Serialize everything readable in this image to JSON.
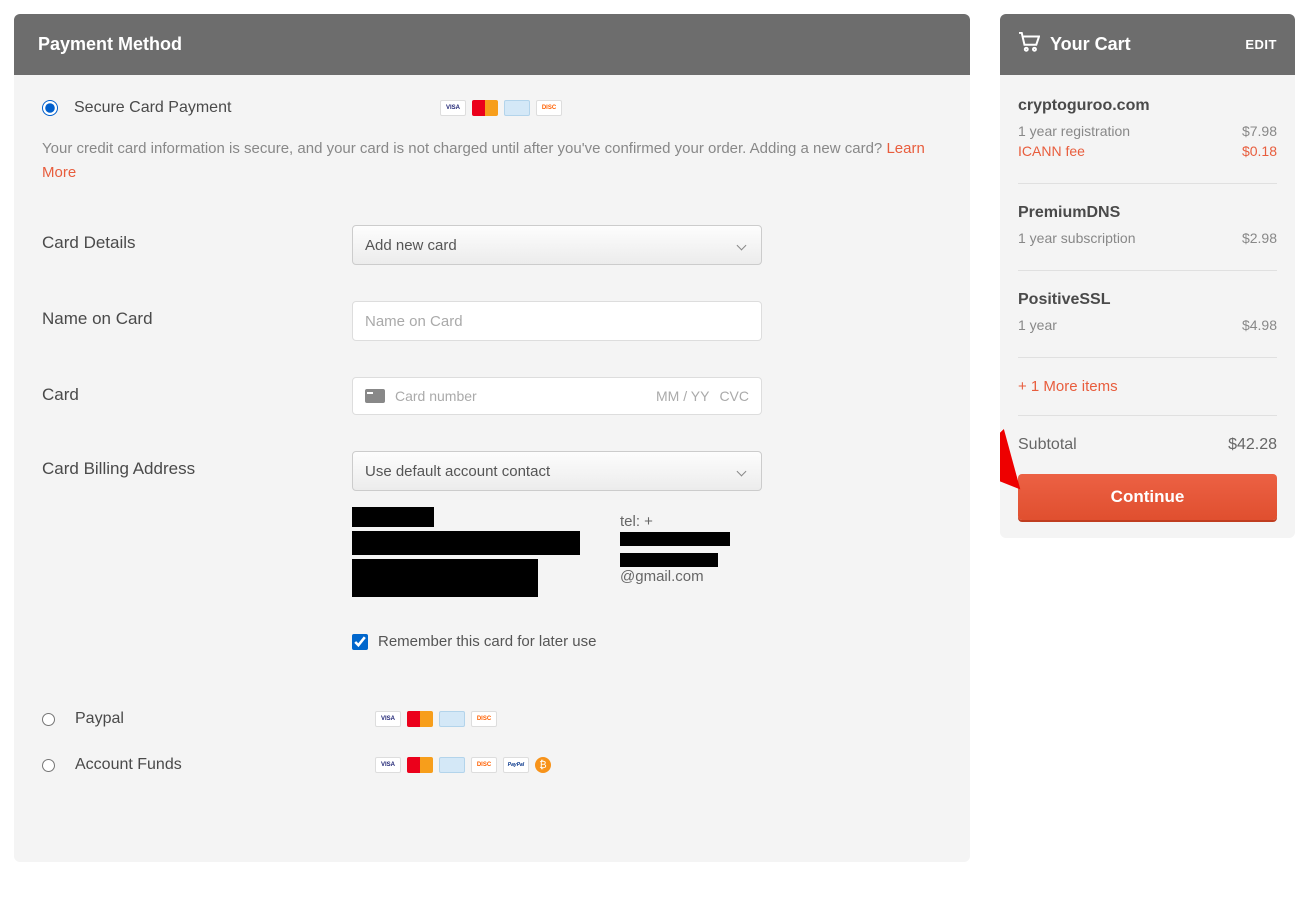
{
  "header": {
    "title": "Payment Method"
  },
  "payment": {
    "secure_label": "Secure Card Payment",
    "info_text_1": "Your credit card information is secure, and your card is not charged until after you've confirmed your order. Adding a new card? ",
    "learn_more": "Learn More",
    "card_details_label": "Card Details",
    "card_details_select": "Add new card",
    "name_label": "Name on Card",
    "name_placeholder": "Name on Card",
    "card_label": "Card",
    "card_number_placeholder": "Card number",
    "card_exp_placeholder": "MM / YY",
    "card_cvc_placeholder": "CVC",
    "billing_label": "Card Billing Address",
    "billing_select": "Use default account contact",
    "tel_prefix": "tel: +",
    "email_suffix": "@gmail.com",
    "remember_label": "Remember this card for later use",
    "paypal_label": "Paypal",
    "funds_label": "Account Funds"
  },
  "cart": {
    "title": "Your Cart",
    "edit": "EDIT",
    "items": [
      {
        "name": "cryptoguroo.com",
        "lines": [
          {
            "desc": "1 year registration",
            "price": "$7.98",
            "fee": false
          },
          {
            "desc": "ICANN fee",
            "price": "$0.18",
            "fee": true
          }
        ]
      },
      {
        "name": "PremiumDNS",
        "lines": [
          {
            "desc": "1 year subscription",
            "price": "$2.98",
            "fee": false
          }
        ]
      },
      {
        "name": "PositiveSSL",
        "lines": [
          {
            "desc": "1 year",
            "price": "$4.98",
            "fee": false
          }
        ]
      }
    ],
    "more": "+ 1 More items",
    "subtotal_label": "Subtotal",
    "subtotal_value": "$42.28",
    "continue": "Continue"
  }
}
